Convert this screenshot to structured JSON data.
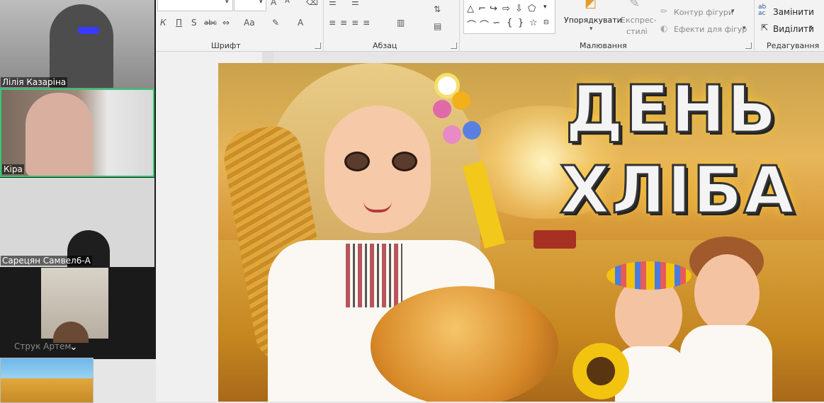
{
  "ribbon": {
    "groups": {
      "font": "Шрифт",
      "paragraph": "Абзац",
      "drawing": "Малювання",
      "editing": "Редагування"
    },
    "font_buttons": {
      "italic": "К",
      "underline": "П",
      "bold_s": "S",
      "strike": "abc",
      "case": "Aa",
      "grow": "A",
      "shrink": "A"
    },
    "arrange_label": "Упорядкувати",
    "quick_styles_label_1": "Експрес-",
    "quick_styles_label_2": "стилі",
    "shape_outline": "Контур фігури",
    "shape_effects": "Ефекти для фігур",
    "replace": "Замінити",
    "select": "Виділити",
    "replace_icon_text": "ab\nac"
  },
  "slide": {
    "title_line1": "ДЕНЬ",
    "title_line2": "ХЛІБА"
  },
  "participants": [
    {
      "name": "Лілія Казаріна"
    },
    {
      "name": "Кіра",
      "active": true
    },
    {
      "name": "Сарецян Самвел6-А"
    },
    {
      "name": "Струк Артем"
    }
  ],
  "colors": {
    "active_speaker": "#2ecc71",
    "title_fill": "#f4f4f4",
    "title_outline": "#333333",
    "video_bg": "#1a1a1a"
  },
  "icons": [
    "bold-icon",
    "underline-icon",
    "strikethrough-icon",
    "font-case-icon",
    "font-color-icon",
    "paragraph-align-icons",
    "shapes-gallery",
    "arrange-icon",
    "quick-styles-icon",
    "outline-icon",
    "effects-icon",
    "replace-icon",
    "select-cursor-icon",
    "chevron-down-icon"
  ]
}
